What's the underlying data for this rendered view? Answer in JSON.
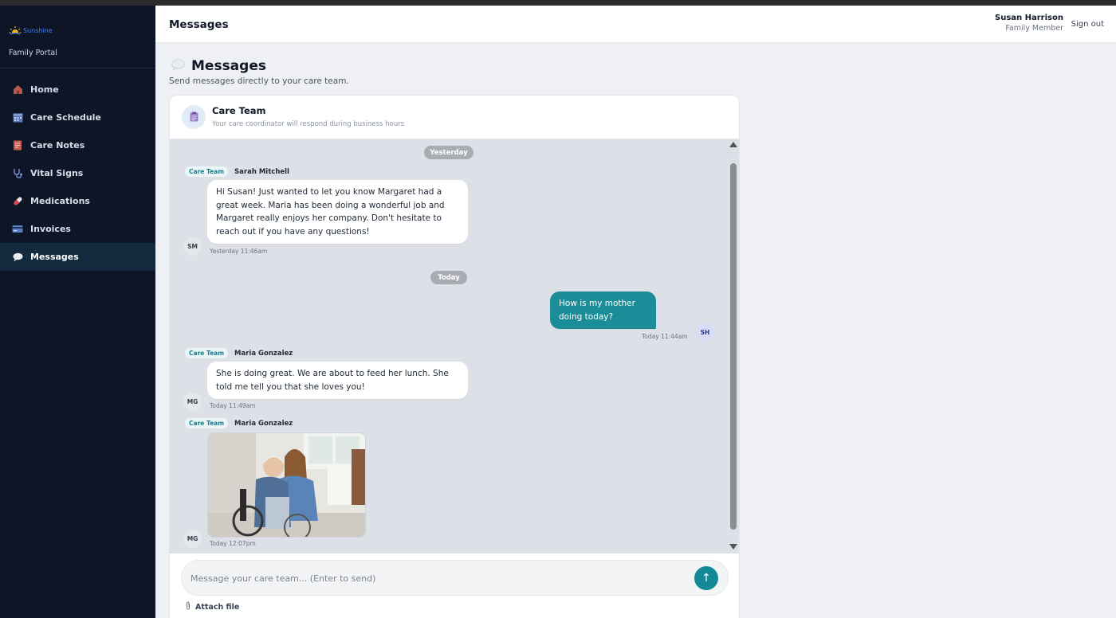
{
  "sidebar": {
    "logo_text": "Sunshine",
    "portal_label": "Family Portal",
    "items": [
      {
        "label": "Home",
        "icon": "house-icon"
      },
      {
        "label": "Care Schedule",
        "icon": "calendar-icon"
      },
      {
        "label": "Care Notes",
        "icon": "notepad-icon"
      },
      {
        "label": "Vital Signs",
        "icon": "stethoscope-icon"
      },
      {
        "label": "Medications",
        "icon": "pill-icon"
      },
      {
        "label": "Invoices",
        "icon": "credit-card-icon"
      },
      {
        "label": "Messages",
        "icon": "speech-bubble-icon",
        "active": true
      }
    ]
  },
  "header": {
    "title": "Messages",
    "user_name": "Susan Harrison",
    "user_role": "Family Member",
    "signout": "Sign out"
  },
  "page": {
    "title": "Messages",
    "subtitle": "Send messages directly to your care team."
  },
  "conversation": {
    "title": "Care Team",
    "subtitle": "Your care coordinator will respond during business hours",
    "day_labels": {
      "yesterday": "Yesterday",
      "today": "Today"
    },
    "messages": [
      {
        "badge": "Care Team",
        "sender": "Sarah Mitchell",
        "initials": "SM",
        "text": "Hi Susan! Just wanted to let you know Margaret had a great week. Maria has been doing a wonderful job and Margaret really enjoys her company. Don't hesitate to reach out if you have any questions!",
        "time": "Yesterday 11:46am"
      },
      {
        "initials": "SH",
        "text": "How is my mother doing today?",
        "time": "Today 11:44am"
      },
      {
        "badge": "Care Team",
        "sender": "Maria Gonzalez",
        "initials": "MG",
        "text": "She is doing great. We are about to feed her lunch. She told me tell you that she loves you!",
        "time": "Today 11:49am"
      },
      {
        "badge": "Care Team",
        "sender": "Maria Gonzalez",
        "initials": "MG",
        "time": "Today 12:07pm"
      }
    ]
  },
  "composer": {
    "placeholder": "Message your care team... (Enter to send)",
    "attach_label": "Attach file",
    "send_icon": "arrow-up-icon"
  },
  "colors": {
    "sidebar_bg": "#0d1526",
    "accent": "#138996",
    "chat_bg": "#dde0e6"
  }
}
